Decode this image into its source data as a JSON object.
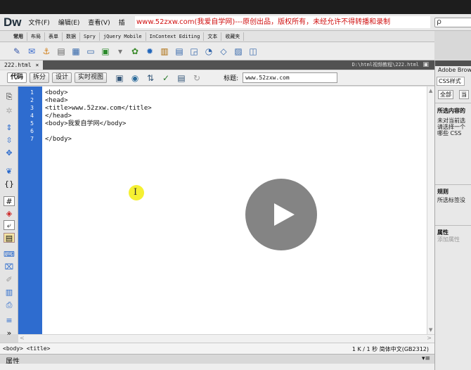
{
  "app": {
    "logo": "Dw"
  },
  "menu": [
    {
      "label": "文件(F)"
    },
    {
      "label": "编辑(E)"
    },
    {
      "label": "查看(V)"
    },
    {
      "label": "插"
    }
  ],
  "watermark": "www.52zxw.com(我爱自学网)---原创出品，版权所有，未经允许不得转播和录制",
  "search": {
    "icon": "search-icon",
    "glyph": "ρ"
  },
  "insert_tabs": [
    "常用",
    "布局",
    "表单",
    "数据",
    "Spry",
    "jQuery Mobile",
    "InContext Editing",
    "文本",
    "收藏夹"
  ],
  "document": {
    "tab_name": "222.html",
    "close": "×",
    "path": "D:\\html视频教程\\222.html",
    "views": [
      "代码",
      "拆分",
      "设计",
      "实时视图"
    ],
    "title_label": "标题:",
    "title_value": "www.52zxw.com"
  },
  "code": {
    "line_numbers": [
      "1",
      "2",
      "3",
      "4",
      "5",
      "6",
      "7"
    ],
    "lines": [
      "<body>",
      "<head>",
      "<title>www.52zxw.com</title>",
      "</head>",
      "<body>我爱自学网</body>",
      "",
      "</body>"
    ]
  },
  "status": {
    "tag_path": "<body> <title>",
    "info": "1 K / 1 秒 简体中文(GB2312)"
  },
  "properties": {
    "label": "属性",
    "menu": "▾≡"
  },
  "right_panel": {
    "title": "Adobe Brow",
    "tab": "CSS样式",
    "btn_all": "全部",
    "btn_current": "当",
    "selected_head": "所选内容的",
    "selected_text": "未对当前选\n请选择一个\n哪些 CSS",
    "rules_head": "规则",
    "rules_text": "所选标签没",
    "props_head": "属性",
    "props_text": "添加属性"
  }
}
